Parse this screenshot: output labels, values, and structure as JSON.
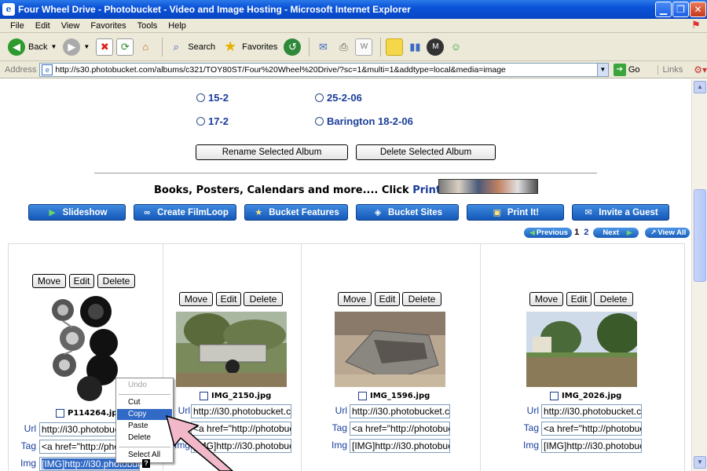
{
  "window": {
    "title": "Four Wheel Drive - Photobucket - Video and Image Hosting - Microsoft Internet Explorer"
  },
  "menu": [
    "File",
    "Edit",
    "View",
    "Favorites",
    "Tools",
    "Help"
  ],
  "toolbar": {
    "back": "Back",
    "search": "Search",
    "favorites": "Favorites"
  },
  "address": {
    "label": "Address",
    "url": "http://s30.photobucket.com/albums/c321/TOY80ST/Four%20Wheel%20Drive/?sc=1&multi=1&addtype=local&media=image",
    "go": "Go",
    "links": "Links"
  },
  "albums": {
    "items": [
      "15-2",
      "25-2-06",
      "17-2",
      "Barington 18-2-06"
    ],
    "rename_button": "Rename Selected Album",
    "delete_button": "Delete Selected Album"
  },
  "promo": {
    "text": "Books, Posters, Calendars and more.... Click ",
    "link": "PrintIt!"
  },
  "nav_buttons": [
    "Slideshow",
    "Create FilmLoop",
    "Bucket Features",
    "Bucket Sites",
    "Print It!",
    "Invite a Guest"
  ],
  "pager": {
    "previous": "Previous",
    "page1": "1",
    "page2": "2",
    "next": "Next",
    "view_all": "View All"
  },
  "photo_actions": {
    "move": "Move",
    "edit": "Edit",
    "delete": "Delete"
  },
  "field_labels": {
    "url": "Url",
    "tag": "Tag",
    "img": "Img"
  },
  "photos": [
    {
      "filename": "P114264.jpg",
      "url": "http://i30.photobucket",
      "tag": "<a href=\"http://pho",
      "img": "[IMG]http://i30.photobuc"
    },
    {
      "filename": "IMG_2150.jpg",
      "url": "http://i30.photobucket.cc",
      "tag": "<a href=\"http://photobuc",
      "img": "[IMG]http://i30.photobuc"
    },
    {
      "filename": "IMG_1596.jpg",
      "url": "http://i30.photobucket.cc",
      "tag": "<a href=\"http://photobuc",
      "img": "[IMG]http://i30.photobuc"
    },
    {
      "filename": "IMG_2026.jpg",
      "url": "http://i30.photobucket.cc",
      "tag": "<a href=\"http://photobuc",
      "img": "[IMG]http://i30.photobuc"
    }
  ],
  "context_menu": [
    "Undo",
    "Cut",
    "Copy",
    "Paste",
    "Delete",
    "Select All"
  ],
  "colors": {
    "link_blue": "#1a3d9a",
    "selection": "#316ac5",
    "nav_blue": "#1458b8",
    "arrow_pink": "#f0b8c8"
  }
}
